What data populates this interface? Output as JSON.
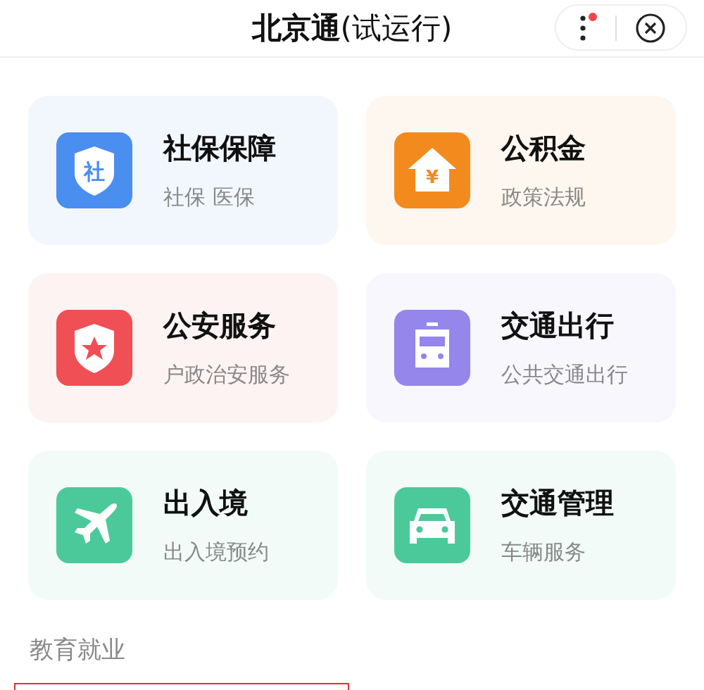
{
  "header": {
    "title": "北京通",
    "suffix": "(试运行)",
    "menu_badge": true
  },
  "services": [
    {
      "title": "社保保障",
      "subtitle": "社保 医保",
      "icon": {
        "kind": "shield-text",
        "glyph": "社"
      },
      "color": "#4a8ef0"
    },
    {
      "title": "公积金",
      "subtitle": "政策法规",
      "icon": {
        "kind": "house",
        "glyph": "¥"
      },
      "color": "#f38a1e"
    },
    {
      "title": "公安服务",
      "subtitle": "户政治安服务",
      "icon": {
        "kind": "shield-star"
      },
      "color": "#ef4f55"
    },
    {
      "title": "交通出行",
      "subtitle": "公共交通出行",
      "icon": {
        "kind": "bus"
      },
      "color": "#9486ea"
    },
    {
      "title": "出入境",
      "subtitle": "出入境预约",
      "icon": {
        "kind": "plane"
      },
      "color": "#4cc99a"
    },
    {
      "title": "交通管理",
      "subtitle": "车辆服务",
      "icon": {
        "kind": "car"
      },
      "color": "#4cc99a"
    }
  ],
  "next_section": {
    "title": "教育就业"
  }
}
